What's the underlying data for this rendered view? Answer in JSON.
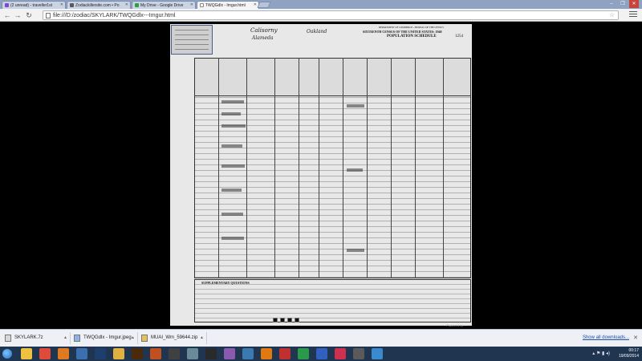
{
  "browser": {
    "tabs": [
      {
        "label": "(2 unread) - traveller1st",
        "favicon_color": "#7a4bd1",
        "active": false
      },
      {
        "label": "Zodiackillersite.com • Po",
        "favicon_color": "#5a5a5a",
        "active": false
      },
      {
        "label": "My Drive - Google Drive",
        "favicon_color": "#2f9e44",
        "active": false
      },
      {
        "label": "TWQGdlx - Imgur.html",
        "favicon_color": "#ffffff",
        "active": true
      }
    ],
    "url": "file:///D:/zodiac/SKYLARK/TWQGdlx---Imgur.html",
    "window_controls": [
      "–",
      "❐",
      "✕"
    ],
    "nav_icons": [
      "back-icon",
      "forward-icon",
      "reload-icon"
    ]
  },
  "document": {
    "header": {
      "title": "SIXTEENTH CENSUS OF THE UNITED STATES: 1940",
      "dept": "DEPARTMENT OF COMMERCE—BUREAU OF THE CENSUS",
      "schedule": "POPULATION SCHEDULE",
      "sheet_no": "1254",
      "handwritten_state": "Calisorny",
      "handwritten_county": "Alameda",
      "handwritten_place": "Oakland"
    },
    "supplementary_label": "SUPPLEMENTARY QUESTIONS",
    "powered_by": "Powered by ..."
  },
  "downloads": [
    {
      "name": "SKYLARK.7z",
      "icon_color": "#d8d8d8"
    },
    {
      "name": "TWQGdlx - Imgur.jpeg",
      "icon_color": "#8ab4e8"
    },
    {
      "name": "MUAI_Wm_59644.zip",
      "icon_color": "#e3c25a"
    }
  ],
  "downloads_show_all": "Show all downloads...",
  "taskbar": {
    "apps": [
      {
        "name": "explorer-icon",
        "color": "#f0c040"
      },
      {
        "name": "chrome-icon",
        "color": "#e04a3a"
      },
      {
        "name": "firefox-icon",
        "color": "#e07a20"
      },
      {
        "name": "thunderbird-icon",
        "color": "#3a6fb0"
      },
      {
        "name": "photoshop-icon",
        "color": "#1e3f6e"
      },
      {
        "name": "folder-icon",
        "color": "#e0b040"
      },
      {
        "name": "illustrator-icon",
        "color": "#4a2a0a"
      },
      {
        "name": "app-icon-8",
        "color": "#c05020"
      },
      {
        "name": "app-icon-9",
        "color": "#404040"
      },
      {
        "name": "app-icon-10",
        "color": "#6a8a9a"
      },
      {
        "name": "app-icon-11",
        "color": "#2a2a2a"
      },
      {
        "name": "app-icon-12",
        "color": "#8a5ab0"
      },
      {
        "name": "app-icon-13",
        "color": "#3a7ab0"
      },
      {
        "name": "vlc-icon",
        "color": "#e07a10"
      },
      {
        "name": "app-icon-15",
        "color": "#c03030"
      },
      {
        "name": "app-icon-16",
        "color": "#2a9a4a"
      },
      {
        "name": "app-icon-17",
        "color": "#3060c0"
      },
      {
        "name": "app-icon-18",
        "color": "#d03050"
      },
      {
        "name": "app-icon-19",
        "color": "#5a5a5a"
      },
      {
        "name": "app-icon-20",
        "color": "#3a8ad0"
      }
    ],
    "clock_time": "00:17",
    "clock_date": "19/09/2014"
  }
}
